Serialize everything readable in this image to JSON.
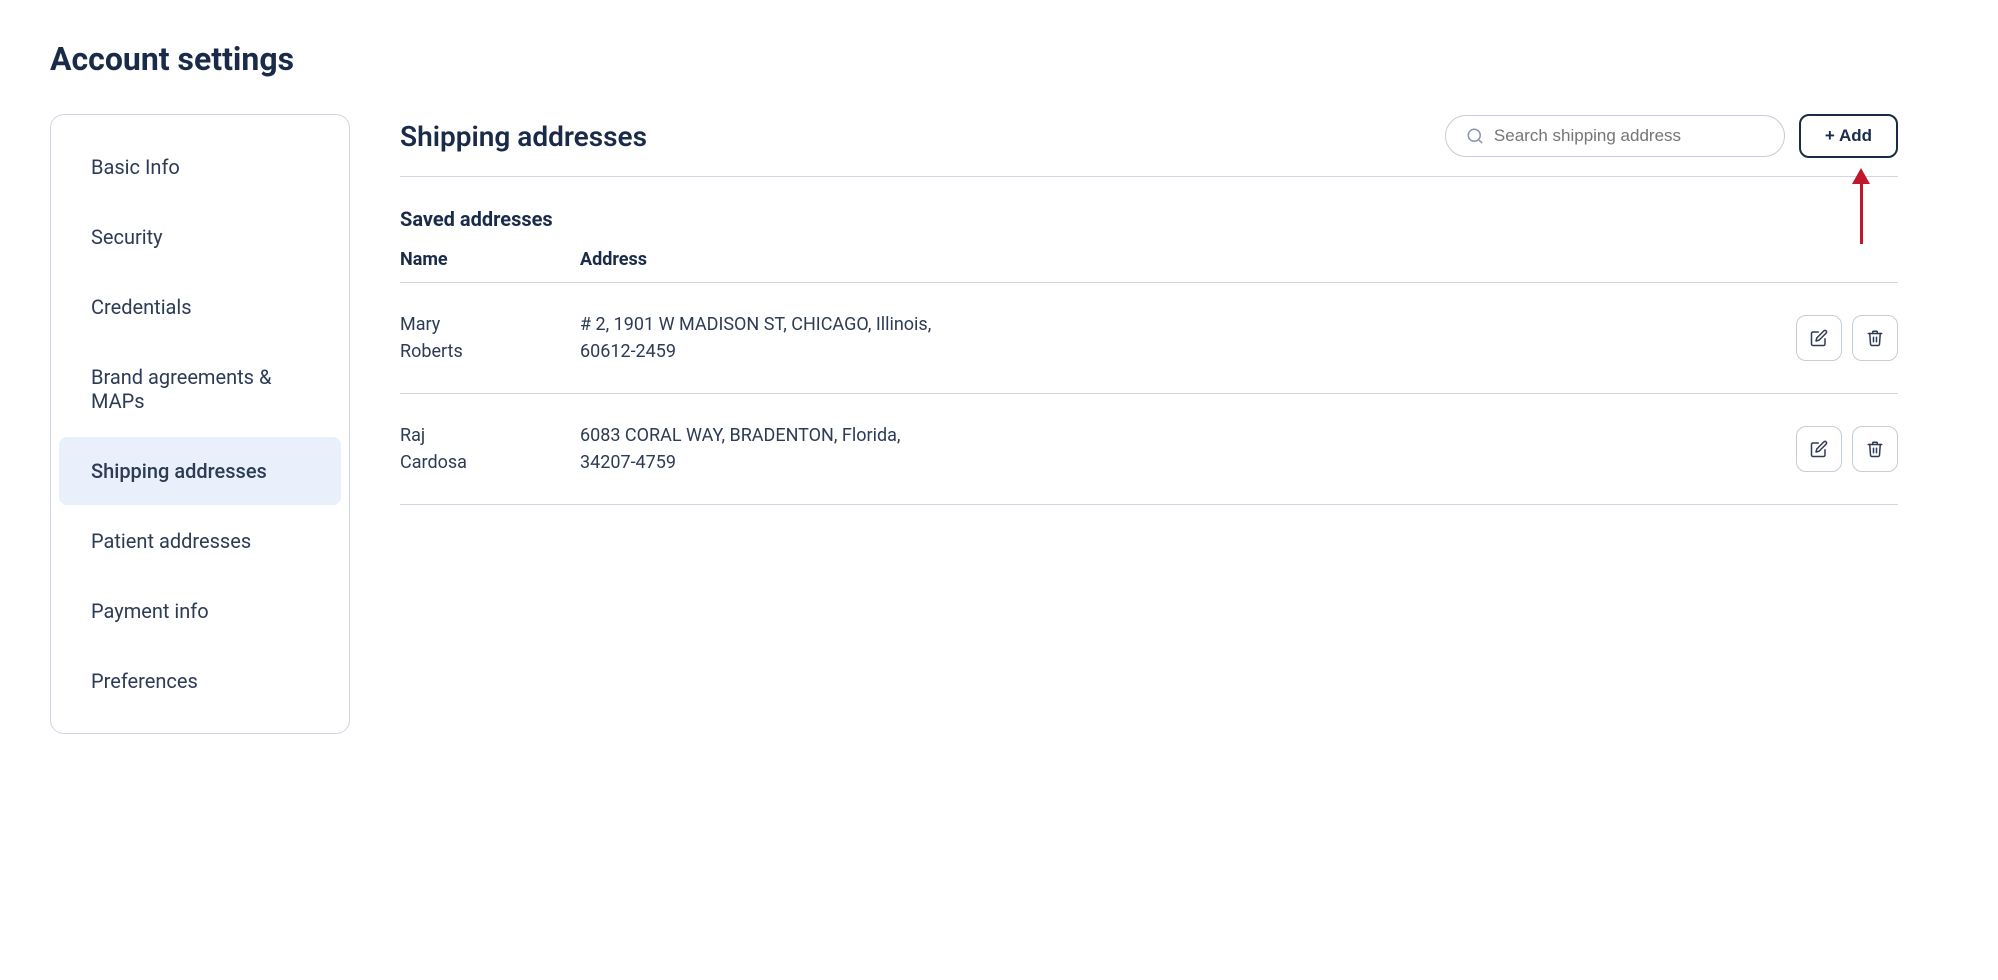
{
  "page": {
    "title": "Account settings"
  },
  "sidebar": {
    "items": [
      {
        "id": "basic-info",
        "label": "Basic Info",
        "active": false
      },
      {
        "id": "security",
        "label": "Security",
        "active": false
      },
      {
        "id": "credentials",
        "label": "Credentials",
        "active": false
      },
      {
        "id": "brand-agreements",
        "label": "Brand agreements & MAPs",
        "active": false
      },
      {
        "id": "shipping-addresses",
        "label": "Shipping addresses",
        "active": true
      },
      {
        "id": "patient-addresses",
        "label": "Patient addresses",
        "active": false
      },
      {
        "id": "payment-info",
        "label": "Payment info",
        "active": false
      },
      {
        "id": "preferences",
        "label": "Preferences",
        "active": false
      }
    ]
  },
  "main": {
    "section_title": "Shipping addresses",
    "search_placeholder": "Search shipping address",
    "add_button_label": "+ Add",
    "saved_label": "Saved addresses",
    "table_headers": {
      "name": "Name",
      "address": "Address"
    },
    "addresses": [
      {
        "name": "Mary\nRoberts",
        "address": "# 2, 1901 W MADISON ST, CHICAGO, Illinois,\n60612-2459"
      },
      {
        "name": "Raj\nCardosa",
        "address": "6083 CORAL WAY, BRADENTON, Florida,\n34207-4759"
      }
    ]
  },
  "icons": {
    "search": "🔍",
    "edit": "✏️",
    "delete": "🗑️"
  }
}
